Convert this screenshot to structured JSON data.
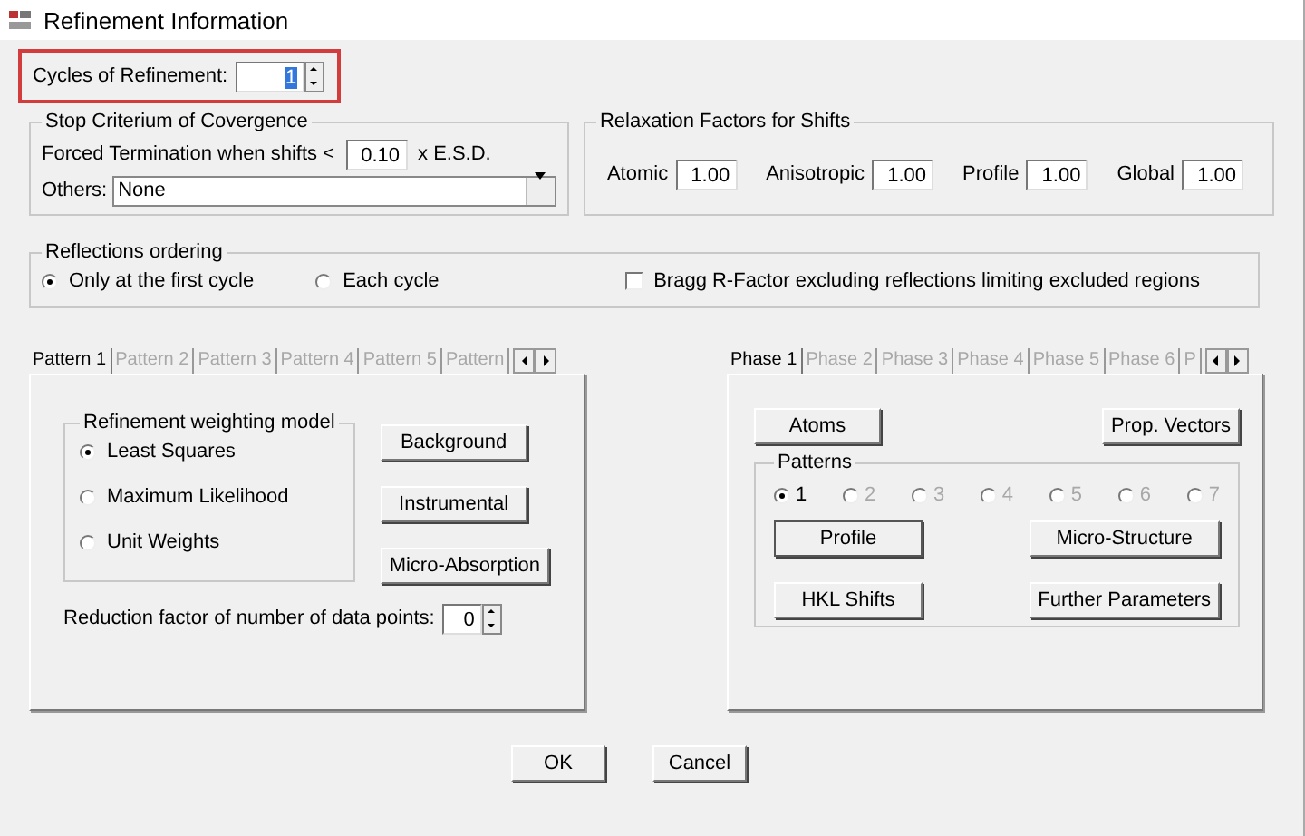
{
  "window": {
    "title": "Refinement Information"
  },
  "cycles": {
    "label": "Cycles of Refinement:",
    "value": "1",
    "highlighted": true
  },
  "stop_criterium": {
    "title": "Stop Criterium of Covergence",
    "forced_label": "Forced Termination when  shifts <",
    "forced_value": "0.10",
    "forced_unit": "x E.S.D.",
    "others_label": "Others:",
    "others_value": "None"
  },
  "relaxation": {
    "title": "Relaxation Factors for Shifts",
    "fields": [
      {
        "label": "Atomic",
        "value": "1.00"
      },
      {
        "label": "Anisotropic",
        "value": "1.00"
      },
      {
        "label": "Profile",
        "value": "1.00"
      },
      {
        "label": "Global",
        "value": "1.00"
      }
    ]
  },
  "reflections": {
    "title": "Reflections ordering",
    "options": [
      {
        "label": "Only at the first cycle",
        "selected": true
      },
      {
        "label": "Each cycle",
        "selected": false
      }
    ],
    "bragg": {
      "label": "Bragg R-Factor excluding  reflections limiting excluded regions",
      "checked": false
    }
  },
  "pattern_tabs": [
    {
      "label": "Pattern 1",
      "selected": true
    },
    {
      "label": "Pattern 2",
      "selected": false
    },
    {
      "label": "Pattern 3",
      "selected": false
    },
    {
      "label": "Pattern 4",
      "selected": false
    },
    {
      "label": "Pattern 5",
      "selected": false
    },
    {
      "label": "Pattern",
      "selected": false
    }
  ],
  "weighting": {
    "title": "Refinement weighting model",
    "options": [
      {
        "label": "Least Squares",
        "selected": true
      },
      {
        "label": "Maximum Likelihood",
        "selected": false
      },
      {
        "label": "Unit Weights",
        "selected": false
      }
    ]
  },
  "pattern_buttons": [
    "Background",
    "Instrumental",
    "Micro-Absorption"
  ],
  "reduction": {
    "label": "Reduction factor of number of data points:",
    "value": "0"
  },
  "phase_tabs": [
    {
      "label": "Phase 1",
      "selected": true
    },
    {
      "label": "Phase 2",
      "selected": false
    },
    {
      "label": "Phase 3",
      "selected": false
    },
    {
      "label": "Phase 4",
      "selected": false
    },
    {
      "label": "Phase 5",
      "selected": false
    },
    {
      "label": "Phase 6",
      "selected": false
    },
    {
      "label": "P",
      "selected": false
    }
  ],
  "phase_buttons": [
    "Atoms",
    "Prop. Vectors"
  ],
  "patterns": {
    "title": "Patterns",
    "options": [
      {
        "label": "1",
        "selected": true,
        "disabled": false
      },
      {
        "label": "2",
        "selected": false,
        "disabled": true
      },
      {
        "label": "3",
        "selected": false,
        "disabled": true
      },
      {
        "label": "4",
        "selected": false,
        "disabled": true
      },
      {
        "label": "5",
        "selected": false,
        "disabled": true
      },
      {
        "label": "6",
        "selected": false,
        "disabled": true
      },
      {
        "label": "7",
        "selected": false,
        "disabled": true
      }
    ],
    "buttons": [
      "Profile",
      "Micro-Structure",
      "HKL Shifts",
      "Further Parameters"
    ]
  },
  "buttons": [
    "OK",
    "Cancel"
  ]
}
